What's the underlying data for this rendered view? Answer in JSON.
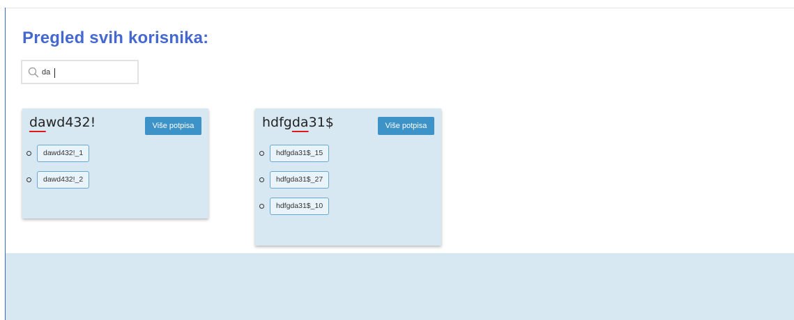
{
  "page": {
    "title": "Pregled svih korisnika:"
  },
  "search": {
    "value": "da",
    "icon": "search-icon"
  },
  "colors": {
    "title": "#4468d0",
    "card_bg": "#d8e8f3",
    "button_bg": "#3d93c8",
    "chip_border": "#6aa6d2",
    "highlight_underline": "#e0181b"
  },
  "users": [
    {
      "name_parts": [
        "",
        "da",
        "wd432!"
      ],
      "button_label": "Više potpisa",
      "signatures": [
        "dawd432!_1",
        "dawd432!_2"
      ]
    },
    {
      "name_parts": [
        "hdfg",
        "da",
        "31$"
      ],
      "button_label": "Više potpisa",
      "signatures": [
        "hdfgda31$_15",
        "hdfgda31$_27",
        "hdfgda31$_10"
      ]
    }
  ]
}
